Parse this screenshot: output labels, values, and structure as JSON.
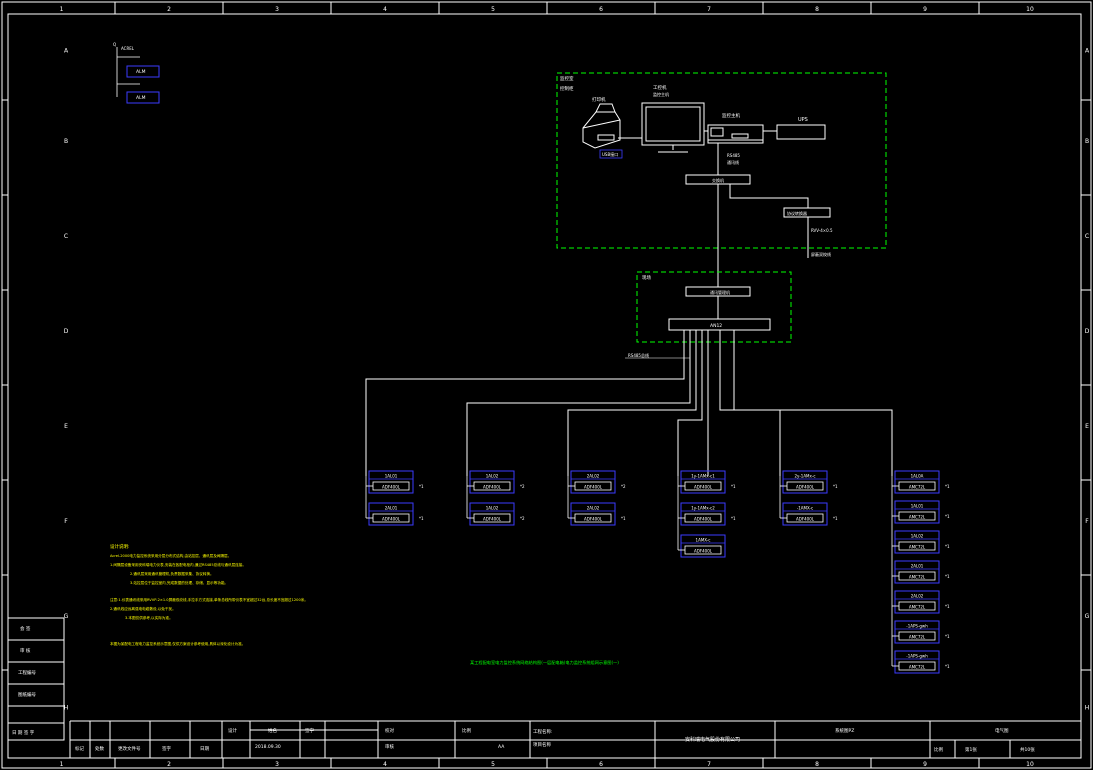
{
  "border": {
    "col_numbers": [
      "1",
      "2",
      "3",
      "4",
      "5",
      "6",
      "7",
      "8",
      "9",
      "10"
    ],
    "row_letters": [
      "A",
      "B",
      "C",
      "D",
      "E",
      "F",
      "G",
      "H"
    ]
  },
  "legend": {
    "items": [
      {
        "label": "Q",
        "tag": "ALM"
      },
      {
        "label": "ACREL",
        "tag": "ALM"
      }
    ]
  },
  "monitor_room": {
    "zone_label": "监控室",
    "zone_sub": "控制柜",
    "printer_label": "打印机",
    "pc_label": "工控机",
    "pc_sub": "监控主机",
    "host_label": "监控主机",
    "ups_label": "UPS",
    "usb_label": "USB接口",
    "rs485_label": "RS485",
    "rs485_sub": "通讯线",
    "switch_label": "交换机",
    "converter_label": "协议转换器",
    "cable_label": "RVV-4×0.5",
    "cable_sub": "屏蔽双绞线"
  },
  "field": {
    "zone_label": "现场",
    "converter_label": "通讯管理机",
    "bus_label": "AN12",
    "bus_note": "RS485总线"
  },
  "meters": [
    {
      "top": "1AL01",
      "model": "ADF400L",
      "count": "*1"
    },
    {
      "top": "2AL01",
      "model": "ADF400L",
      "count": "*1"
    },
    {
      "top": "1AL02",
      "model": "ADF400L",
      "count": "*2"
    },
    {
      "top": "1AL02",
      "model": "ADF400L",
      "count": "*2"
    },
    {
      "top": "2AL02",
      "model": "ADF400L",
      "count": "*2"
    },
    {
      "top": "2AL02",
      "model": "ADF400L",
      "count": "*1"
    },
    {
      "top": "1y-1AMx-c1",
      "model": "ADF400L",
      "count": "*1"
    },
    {
      "top": "1y-1AMx-c2",
      "model": "ADF400L",
      "count": "*1"
    },
    {
      "top": "1AMX-c",
      "model": "ADF400L",
      "count": ""
    },
    {
      "top": "2y-1AMx-c",
      "model": "ADF400L",
      "count": "*1"
    },
    {
      "top": "-1AMX-c",
      "model": "ADF400L",
      "count": "*1"
    },
    {
      "top": "1AL0A",
      "model": "AMC72L",
      "count": "*1"
    },
    {
      "top": "1AL01",
      "model": "AMC72L",
      "count": "*1"
    },
    {
      "top": "1AL02",
      "model": "AMC72L",
      "count": "*1"
    },
    {
      "top": "2AL01",
      "model": "AMC72L",
      "count": "*1"
    },
    {
      "top": "2AL02",
      "model": "AMC72L",
      "count": "*1"
    },
    {
      "top": "-1APS-gwh",
      "model": "AMC72L",
      "count": "*1"
    },
    {
      "top": "-1APS-gwh",
      "model": "AMC72L",
      "count": "*1"
    }
  ],
  "notes": {
    "title": "设计说明:",
    "lines": [
      "Acrel-2000电力监控系统采用分层分布式结构,由站控层、通讯层及间隔层。",
      "1.间隔层设备采用安科瑞电力仪表,安装在各配电柜内,通过RS485总线与通讯层连接。",
      "2.通讯层采用通讯管理机,负责数据采集、协议转换。",
      "3.站控层位于监控室内,完成数据的处理、存储、显示等功能。",
      "",
      "注意:1.仪表通讯线采用RVVP-2×1.0屏蔽双绞线,手拉手方式连接,单条总线所带仪表不宜超过32台,总长度不宜超过1200米。",
      "2.通讯线应远离强电电缆敷设,以免干扰。",
      "3.本图仅供参考,以实际为准。",
      "",
      "本图为某配电工程电力监控系统示意图,仅供方案设计参考使用,具体以深化设计为准。"
    ]
  },
  "drawing_title": "某工程配电室电力监控系统网络结构图(一层配电箱)电力监控系统组网示意图(一)",
  "side_table": {
    "rows": [
      "会 签",
      "审 核",
      "工程编号",
      "图纸编号",
      "日 期  签 字"
    ]
  },
  "title_block": {
    "labels": [
      "标记",
      "处数",
      "更改文件号",
      "签字",
      "日期",
      "设计",
      "校对",
      "审核",
      "批准",
      "工程名称:",
      "图纸名称:",
      "比例",
      "第1张",
      "共10张"
    ],
    "cells": {
      "design": "设计",
      "name": "姓名",
      "signature": "签字",
      "date": "2018.09.30",
      "check": "校对",
      "approve": "审核",
      "scale_label": "比例",
      "scale": "AA",
      "project_label": "工程名称:",
      "project_sub": "项目名称",
      "company": "安科瑞电气股份有限公司",
      "drawing_no_label": "图纸编号",
      "drawing_no": "电气图",
      "sheet": "第1张",
      "total": "共10张",
      "rev": "版次",
      "stage": "阶段",
      "revmark": "标记",
      "count": "处数",
      "file": "更改文件号",
      "sign2": "签字",
      "date2": "日期",
      "drawing_title_short": "系统图PZ"
    }
  }
}
